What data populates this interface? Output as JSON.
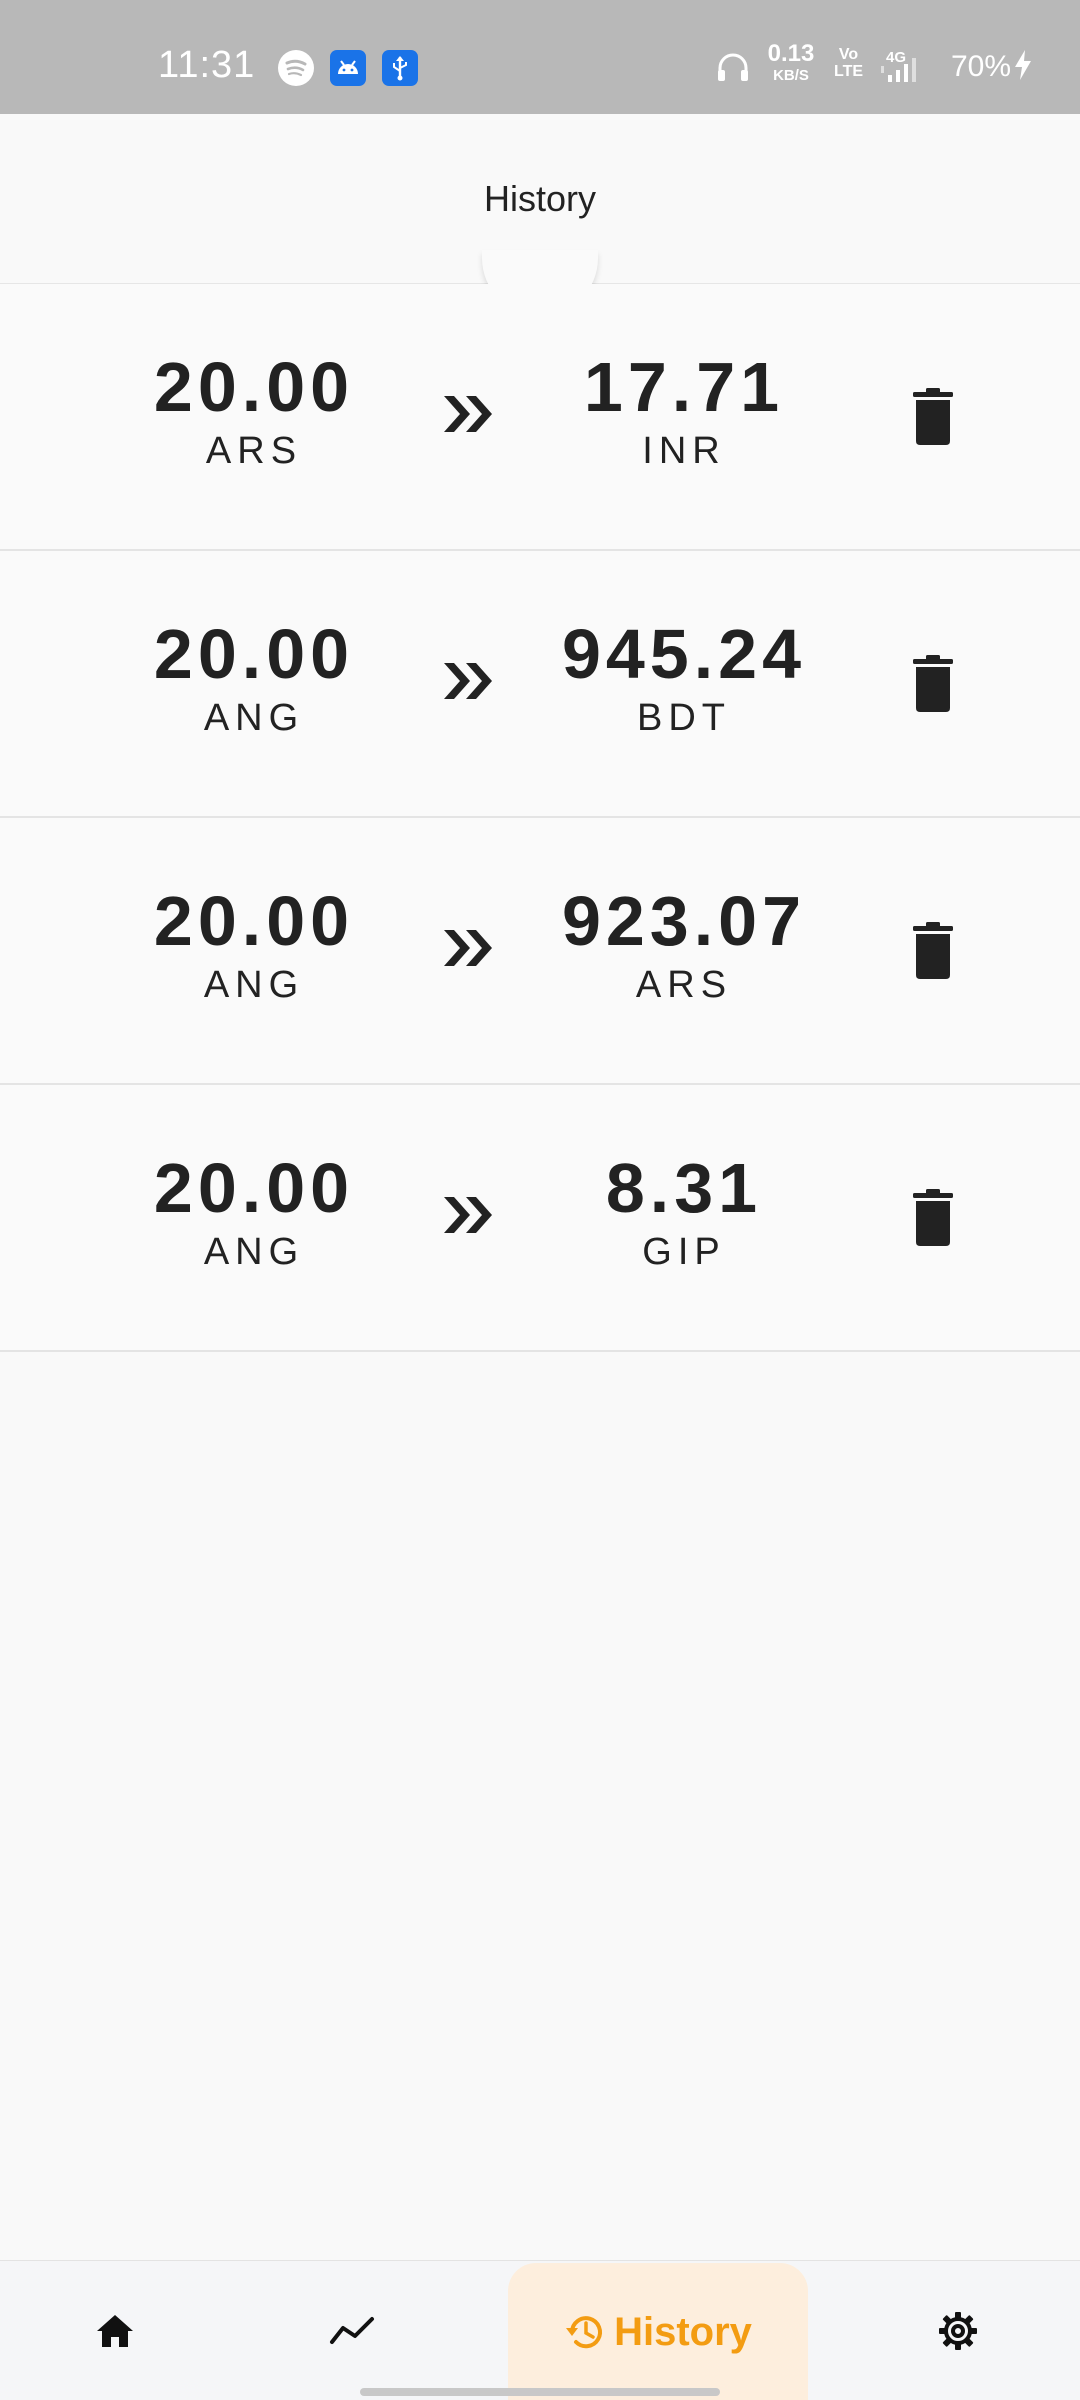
{
  "status_bar": {
    "time": "11:31",
    "net_speed_value": "0.13",
    "net_speed_unit": "KB/S",
    "volte_top": "Vo",
    "volte_bottom": "LTE",
    "network": "4G",
    "battery": "70%",
    "icons": [
      "spotify-icon",
      "android-icon",
      "usb-icon",
      "headphones-icon",
      "signal-icon",
      "charging-icon"
    ]
  },
  "app_bar": {
    "title": "History"
  },
  "history": [
    {
      "from_amount": "20.00",
      "from_code": "ARS",
      "to_amount": "17.71",
      "to_code": "INR"
    },
    {
      "from_amount": "20.00",
      "from_code": "ANG",
      "to_amount": "945.24",
      "to_code": "BDT"
    },
    {
      "from_amount": "20.00",
      "from_code": "ANG",
      "to_amount": "923.07",
      "to_code": "ARS"
    },
    {
      "from_amount": "20.00",
      "from_code": "ANG",
      "to_amount": "8.31",
      "to_code": "GIP"
    }
  ],
  "bottom_nav": {
    "items": [
      {
        "id": "home",
        "icon": "home-icon",
        "label": ""
      },
      {
        "id": "trends",
        "icon": "trend-line-icon",
        "label": ""
      },
      {
        "id": "history",
        "icon": "history-icon",
        "label": "History",
        "selected": true
      },
      {
        "id": "settings",
        "icon": "gear-icon",
        "label": ""
      }
    ]
  },
  "colors": {
    "accent": "#f39c12",
    "accent_bg": "#fdeedd",
    "status_bar": "#b8b8b8",
    "text": "#222222"
  }
}
